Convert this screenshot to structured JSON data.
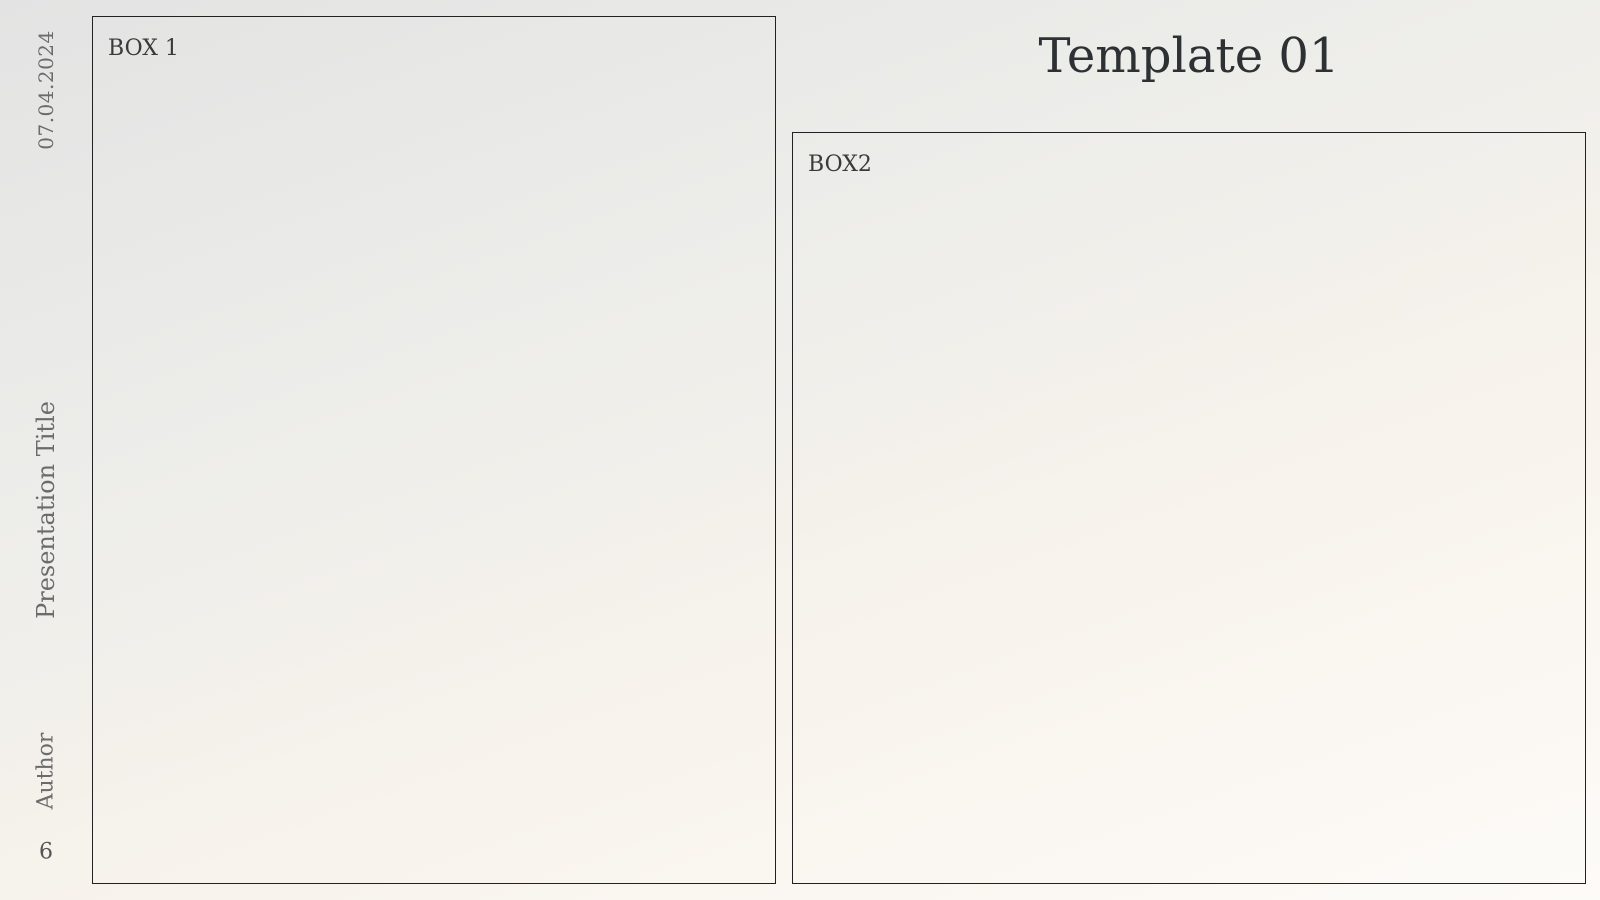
{
  "slide": {
    "title": "Template 01",
    "box1_label": "BOX 1",
    "box2_label": "BOX2"
  },
  "sidebar": {
    "date": "07.04.2024",
    "presentation_title": "Presentation Title",
    "author": "Author",
    "page_number": "6"
  }
}
